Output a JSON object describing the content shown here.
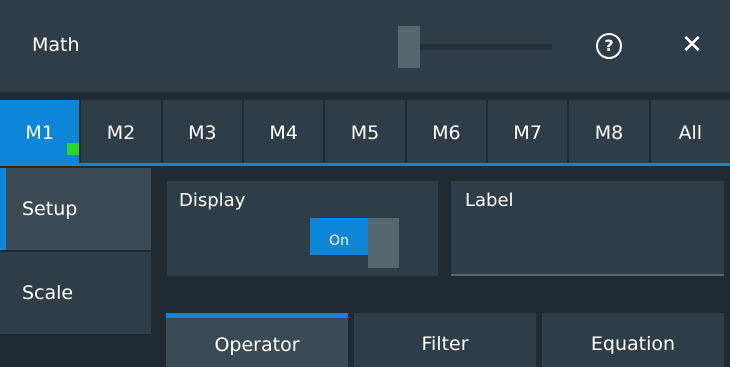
{
  "window": {
    "title": "Math"
  },
  "tabs": [
    {
      "label": "M1",
      "active": true,
      "indicator_color": "#2dd62d"
    },
    {
      "label": "M2"
    },
    {
      "label": "M3"
    },
    {
      "label": "M4"
    },
    {
      "label": "M5"
    },
    {
      "label": "M6"
    },
    {
      "label": "M7"
    },
    {
      "label": "M8"
    },
    {
      "label": "All"
    }
  ],
  "sidebar": {
    "items": [
      {
        "label": "Setup",
        "active": true
      },
      {
        "label": "Scale"
      }
    ]
  },
  "display": {
    "label": "Display",
    "toggle": "On"
  },
  "label_field": {
    "label": "Label",
    "value": ""
  },
  "subtabs": [
    {
      "label": "Operator",
      "active": true
    },
    {
      "label": "Filter"
    },
    {
      "label": "Equation"
    }
  ],
  "icons": {
    "help": "help-circle-icon",
    "close": "close-icon"
  },
  "colors": {
    "accent": "#0d86d8",
    "panel": "#2f3d48",
    "background": "#1f2a33"
  }
}
